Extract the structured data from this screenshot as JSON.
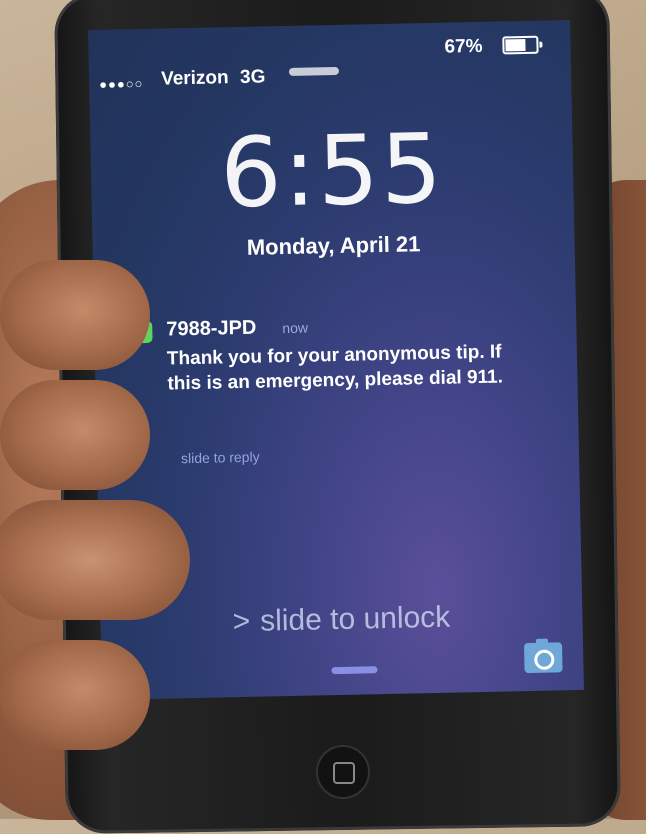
{
  "status_bar": {
    "signal_dots": "●●●○○",
    "carrier": "Verizon",
    "network": "3G",
    "battery_percent": "67%",
    "battery_level": 0.67
  },
  "lock_screen": {
    "time": "6:55",
    "date": "Monday, April 21"
  },
  "notification": {
    "app_icon": "messages-icon",
    "sender": "7988-JPD",
    "timestamp": "now",
    "body": "Thank you for your anonymous tip. If this is an emergency, please dial 911.",
    "action_hint": "slide to reply"
  },
  "unlock": {
    "chevron": ">",
    "label": "slide to unlock"
  },
  "icons": {
    "camera": "camera-icon",
    "home": "home-button-icon"
  },
  "colors": {
    "accent_messages": "#5fd45f",
    "camera": "#6fa8d8",
    "reply_hint": "#8fa5dd"
  }
}
